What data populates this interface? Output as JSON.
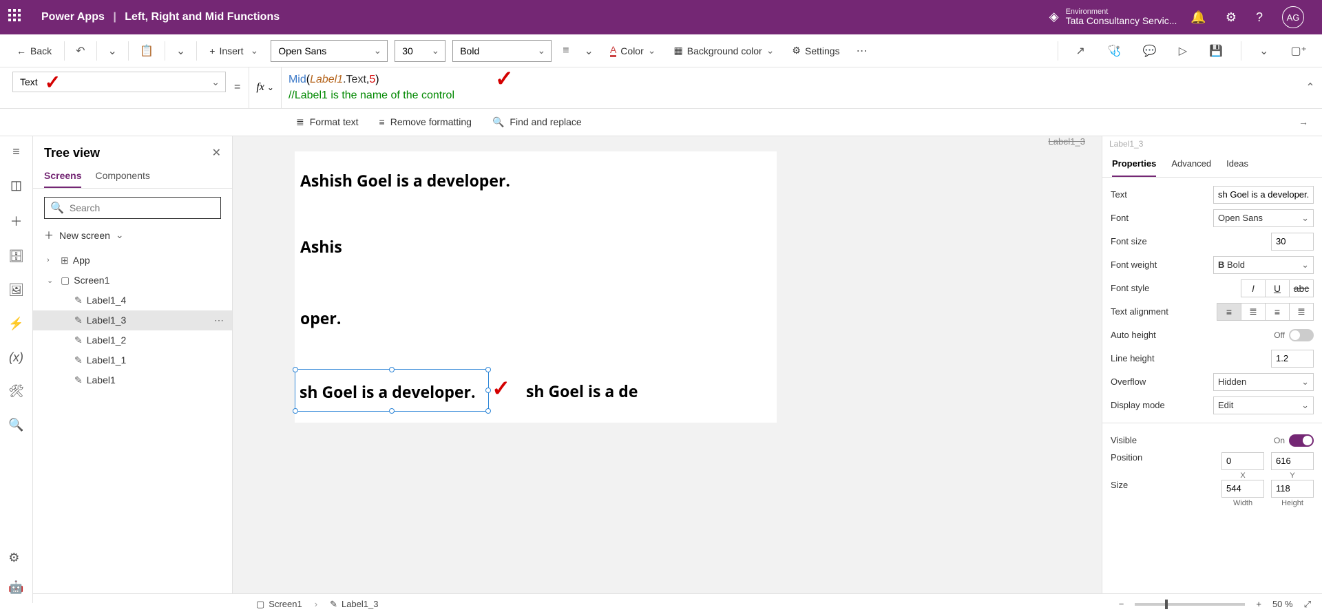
{
  "header": {
    "app_name": "Power Apps",
    "page_title": "Left, Right and Mid Functions",
    "environment_label": "Environment",
    "environment_name": "Tata Consultancy Servic...",
    "user_initials": "AG"
  },
  "toolbar": {
    "back": "Back",
    "insert": "Insert",
    "font": "Open Sans",
    "font_size": "30",
    "font_weight": "Bold",
    "color": "Color",
    "background_color": "Background color",
    "settings": "Settings"
  },
  "property_selector": "Text",
  "formula": {
    "fn": "Mid",
    "id": "Label1",
    "prop": ".Text",
    "num": "5",
    "comment": "//Label1 is the name of the control"
  },
  "formula_tools": {
    "format": "Format text",
    "remove": "Remove formatting",
    "find": "Find and replace"
  },
  "tree": {
    "title": "Tree view",
    "tab_screens": "Screens",
    "tab_components": "Components",
    "search_placeholder": "Search",
    "new_screen": "New screen",
    "app": "App",
    "screen": "Screen1",
    "items": [
      "Label1_4",
      "Label1_3",
      "Label1_2",
      "Label1_1",
      "Label1"
    ],
    "selected": "Label1_3"
  },
  "canvas": {
    "label_full": "Ashish Goel is a developer.",
    "label_left": "Ashis",
    "label_right": "oper.",
    "label_mid_selected": "sh Goel is a developer.",
    "label_mid2": "sh Goel is a de"
  },
  "props_crumb": "Label1_3",
  "props": {
    "tab_properties": "Properties",
    "tab_advanced": "Advanced",
    "tab_ideas": "Ideas",
    "text_label": "Text",
    "text_value": "sh Goel is a developer.",
    "font_label": "Font",
    "font_value": "Open Sans",
    "font_size_label": "Font size",
    "font_size_value": "30",
    "font_weight_label": "Font weight",
    "font_weight_value": "Bold",
    "font_weight_prefix": "B",
    "font_style_label": "Font style",
    "text_align_label": "Text alignment",
    "auto_height_label": "Auto height",
    "auto_height_value": "Off",
    "line_height_label": "Line height",
    "line_height_value": "1.2",
    "overflow_label": "Overflow",
    "overflow_value": "Hidden",
    "display_mode_label": "Display mode",
    "display_mode_value": "Edit",
    "visible_label": "Visible",
    "visible_value": "On",
    "position_label": "Position",
    "pos_x": "0",
    "pos_y": "616",
    "pos_x_sub": "X",
    "pos_y_sub": "Y",
    "size_label": "Size",
    "size_w": "544",
    "size_h": "118",
    "size_w_sub": "Width",
    "size_h_sub": "Height"
  },
  "statusbar": {
    "screen": "Screen1",
    "control": "Label1_3",
    "zoom": "50  %"
  }
}
